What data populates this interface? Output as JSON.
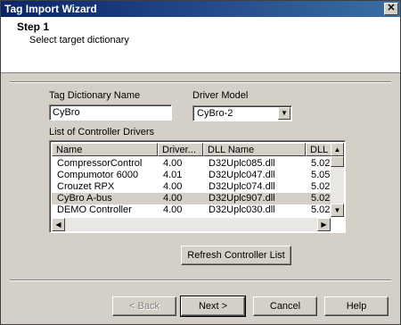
{
  "window": {
    "title": "Tag Import Wizard",
    "close_glyph": "✕"
  },
  "header": {
    "step": "Step 1",
    "subtitle": "Select target dictionary"
  },
  "form": {
    "dict_label": "Tag Dictionary Name",
    "dict_value": "CyBro",
    "driver_label": "Driver Model",
    "driver_value": "CyBro-2",
    "list_label": "List of Controller Drivers"
  },
  "table": {
    "columns": [
      "Name",
      "Driver...",
      "DLL Name",
      "DLL ..."
    ],
    "rows": [
      [
        "CompressorControl",
        "4.00",
        "D32Uplc085.dll",
        "5.02"
      ],
      [
        "Compumotor 6000",
        "4.01",
        "D32Uplc047.dll",
        "5.05"
      ],
      [
        "Crouzet RPX",
        "4.00",
        "D32Uplc074.dll",
        "5.02"
      ],
      [
        "CyBro A-bus",
        "4.00",
        "D32Uplc907.dll",
        "5.02"
      ],
      [
        "DEMO Controller",
        "4.00",
        "D32Uplc030.dll",
        "5.02"
      ]
    ],
    "selected_row": 3
  },
  "buttons": {
    "refresh": "Refresh Controller List",
    "back": "< Back",
    "next": "Next >",
    "cancel": "Cancel",
    "help": "Help"
  },
  "icons": {
    "scroll_up": "up-arrow",
    "scroll_down": "down-arrow",
    "scroll_left": "left-arrow",
    "scroll_right": "right-arrow",
    "dropdown": "down-arrow"
  }
}
